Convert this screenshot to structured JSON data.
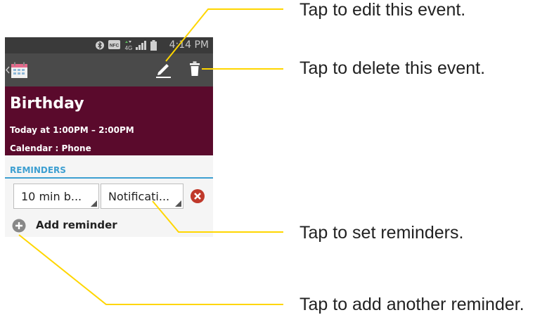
{
  "status_bar": {
    "time": "4:14 PM",
    "nfc": "NFC",
    "network": "4G"
  },
  "event": {
    "title": "Birthday",
    "time": "Today at 1:00PM – 2:00PM",
    "calendar": "Calendar : Phone"
  },
  "reminders": {
    "header": "REMINDERS",
    "time_value": "10 min b...",
    "method_value": "Notificati...",
    "add_label": "Add reminder"
  },
  "annotations": {
    "edit": "Tap to edit this event.",
    "delete": "Tap to delete this event.",
    "set_reminders": "Tap to set reminders.",
    "add_reminder": "Tap to add another reminder."
  },
  "colors": {
    "header_bg": "#5a0a2c",
    "accent": "#3d9fd1",
    "callout_line": "#ffd600",
    "delete_red": "#c0392b"
  },
  "icons": [
    "bluetooth-icon",
    "nfc-icon",
    "network-icon",
    "signal-icon",
    "battery-icon",
    "back-icon",
    "calendar-app-icon",
    "edit-icon",
    "trash-icon",
    "remove-reminder-icon",
    "add-reminder-icon"
  ]
}
